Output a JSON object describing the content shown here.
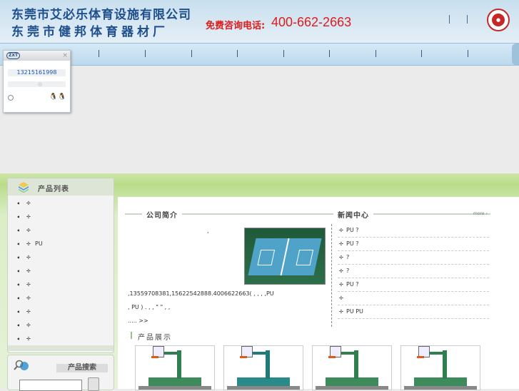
{
  "header": {
    "company_line1": "东莞市艾必乐体育设施有限公司",
    "company_line2": "东莞市健邦体育器材厂",
    "hotline_label": "免费咨询电话:",
    "hotline_number": "400-662-2663",
    "separators": [
      "|",
      "|"
    ]
  },
  "nav": {
    "separators": [
      "|",
      "|",
      "|",
      "|",
      "|",
      "|",
      "|",
      "|",
      "|",
      "|"
    ]
  },
  "qq_widget": {
    "brand": "ZXT",
    "close": "×",
    "phone": "13215161998",
    "small": "◎"
  },
  "sidebar": {
    "title": "产品列表",
    "items": [
      "",
      "",
      "",
      "PU",
      "",
      "",
      "",
      "",
      "",
      "",
      ""
    ],
    "arrow": "➧",
    "bullet": "✢"
  },
  "search": {
    "title": "产品搜索"
  },
  "about": {
    "title": "公司简介",
    "line1": ",",
    "line2": ",13559708381,15622542888.4006622663(        ,        ,        ,        ,PU",
    "line3": ", PU  )    .              ,               ,   \" \"                        ,   ,",
    "line4": "..... >>"
  },
  "news": {
    "title": "新闻中心",
    "more": "more ›",
    "items": [
      {
        "text": "PU        ?"
      },
      {
        "text": " PU        ?"
      },
      {
        "text": "         ?"
      },
      {
        "text": "            ?"
      },
      {
        "text": " PU         ?"
      },
      {
        "text": ""
      },
      {
        "text": "PU      PU"
      }
    ],
    "arrow": "✢"
  },
  "products": {
    "title": "产品展示"
  }
}
